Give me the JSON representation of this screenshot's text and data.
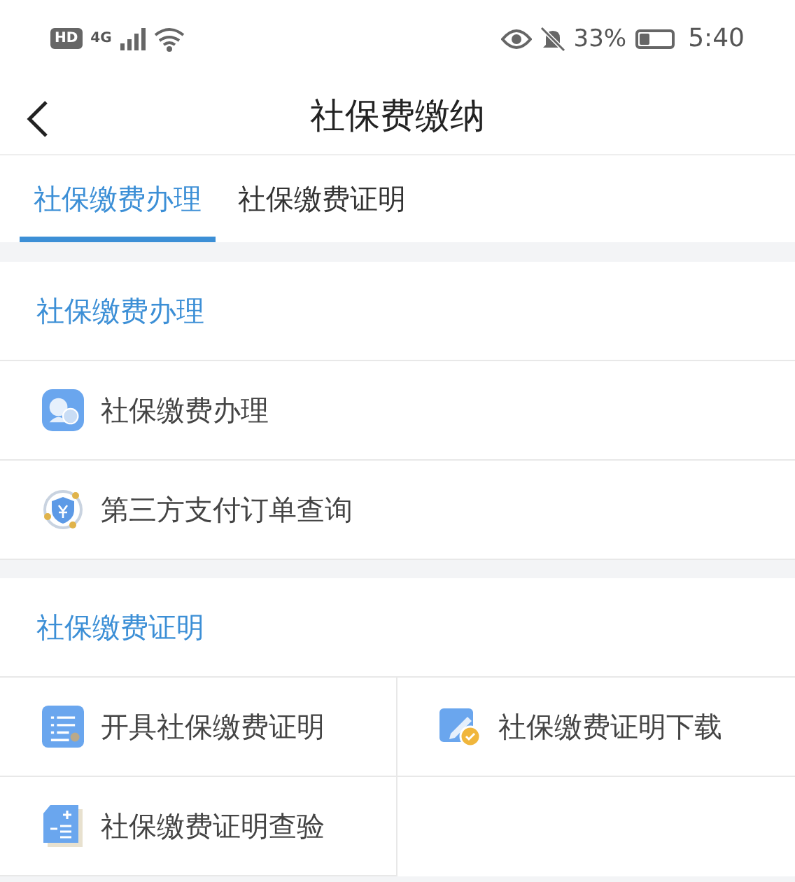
{
  "status_bar": {
    "hd": "HD",
    "network": "4G",
    "battery": "33%",
    "time": "5:40"
  },
  "header": {
    "title": "社保费缴纳"
  },
  "tabs": [
    {
      "label": "社保缴费办理",
      "selected": true
    },
    {
      "label": "社保缴费证明",
      "selected": false
    }
  ],
  "sections": [
    {
      "title": "社保缴费办理",
      "kind": "list",
      "items": [
        {
          "label": "社保缴费办理",
          "kind": "chat"
        },
        {
          "label": "第三方支付订单查询",
          "kind": "shield"
        }
      ]
    },
    {
      "title": "社保缴费证明",
      "kind": "grid",
      "items": [
        {
          "label": "开具社保缴费证明",
          "kind": "list"
        },
        {
          "label": "社保缴费证明下载",
          "kind": "edit"
        },
        {
          "label": "社保缴费证明查验",
          "kind": "calc"
        }
      ]
    }
  ]
}
